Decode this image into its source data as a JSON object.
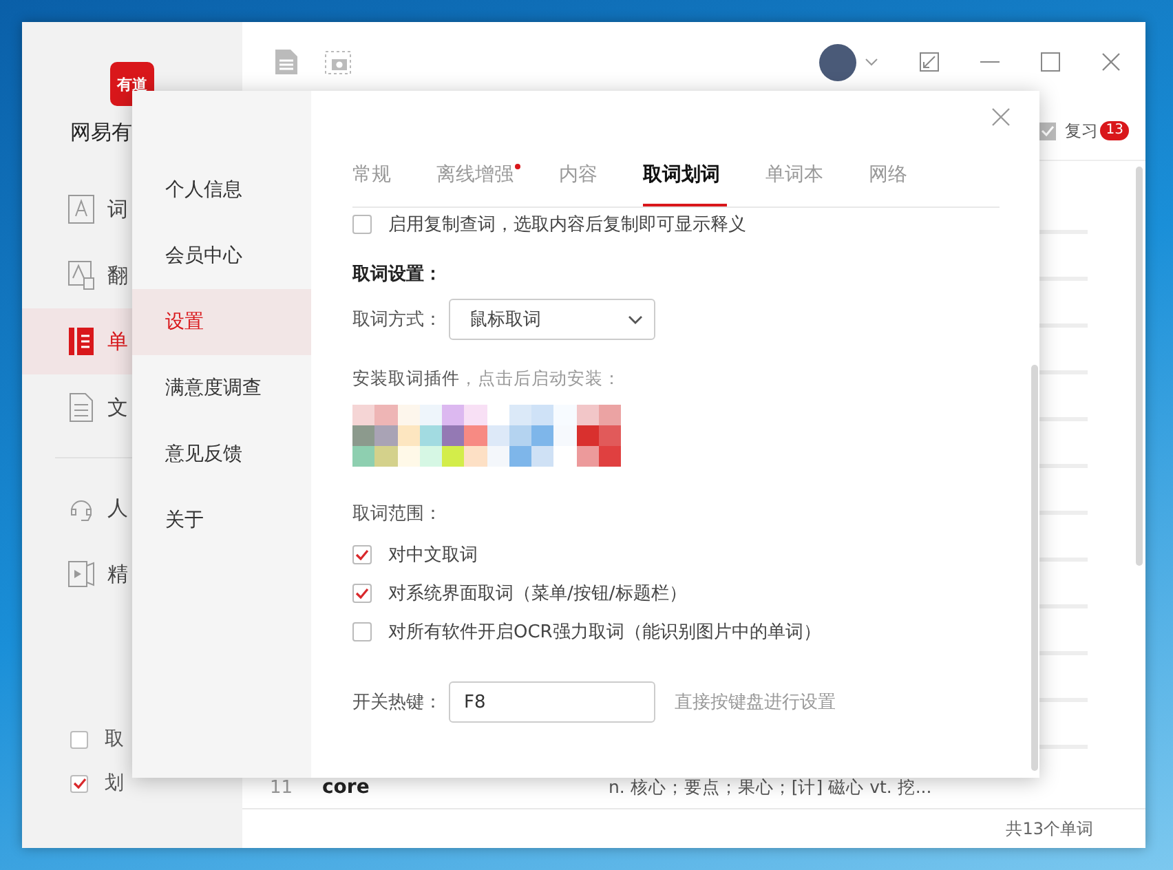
{
  "app": {
    "logo": "有道",
    "name": "网易有",
    "sidebar_top": [
      {
        "kind": "dict",
        "label": "词",
        "selected": false
      },
      {
        "kind": "translate",
        "label": "翻",
        "selected": false
      },
      {
        "kind": "wordbook",
        "label": "单",
        "selected": true
      },
      {
        "kind": "doc",
        "label": "文",
        "selected": false
      }
    ],
    "sidebar_bottom": [
      {
        "kind": "human",
        "label": "人",
        "selected": false
      },
      {
        "kind": "course",
        "label": "精",
        "selected": false
      }
    ],
    "toggles": [
      {
        "label": "取",
        "checked": false
      },
      {
        "label": "划",
        "checked": true
      }
    ],
    "review": {
      "label": "复习",
      "count": "13"
    },
    "rows": [
      {
        "index": "11",
        "word": "core",
        "meaning": "n. 核心；要点；果心；[计] 磁心  vt. 挖..."
      }
    ],
    "status": "共13个单词"
  },
  "dialog": {
    "nav": [
      {
        "label": "个人信息",
        "selected": false
      },
      {
        "label": "会员中心",
        "selected": false
      },
      {
        "label": "设置",
        "selected": true
      },
      {
        "label": "满意度调查",
        "selected": false
      },
      {
        "label": "意见反馈",
        "selected": false
      },
      {
        "label": "关于",
        "selected": false
      }
    ],
    "tabs": [
      {
        "label": "常规",
        "selected": false,
        "dot": false
      },
      {
        "label": "离线增强",
        "selected": false,
        "dot": true
      },
      {
        "label": "内容",
        "selected": false,
        "dot": false
      },
      {
        "label": "取词划词",
        "selected": true,
        "dot": false
      },
      {
        "label": "单词本",
        "selected": false,
        "dot": false
      },
      {
        "label": "网络",
        "selected": false,
        "dot": false
      }
    ],
    "copy_lookup": {
      "label": "启用复制查词，选取内容后复制即可显示释义",
      "checked": false
    },
    "section_title": "取词设置：",
    "mode": {
      "label": "取词方式：",
      "value": "鼠标取词"
    },
    "plugin": {
      "label": "安装取词插件",
      "link": "，点击后启动安装："
    },
    "scope": {
      "label": "取词范围：",
      "options": [
        {
          "label": "对中文取词",
          "checked": true
        },
        {
          "label": "对系统界面取词（菜单/按钮/标题栏）",
          "checked": true
        },
        {
          "label": "对所有软件开启OCR强力取词（能识别图片中的单词）",
          "checked": false
        }
      ]
    },
    "hotkey": {
      "label": "开关热键：",
      "value": "F8",
      "hint": "直接按键盘进行设置"
    }
  }
}
